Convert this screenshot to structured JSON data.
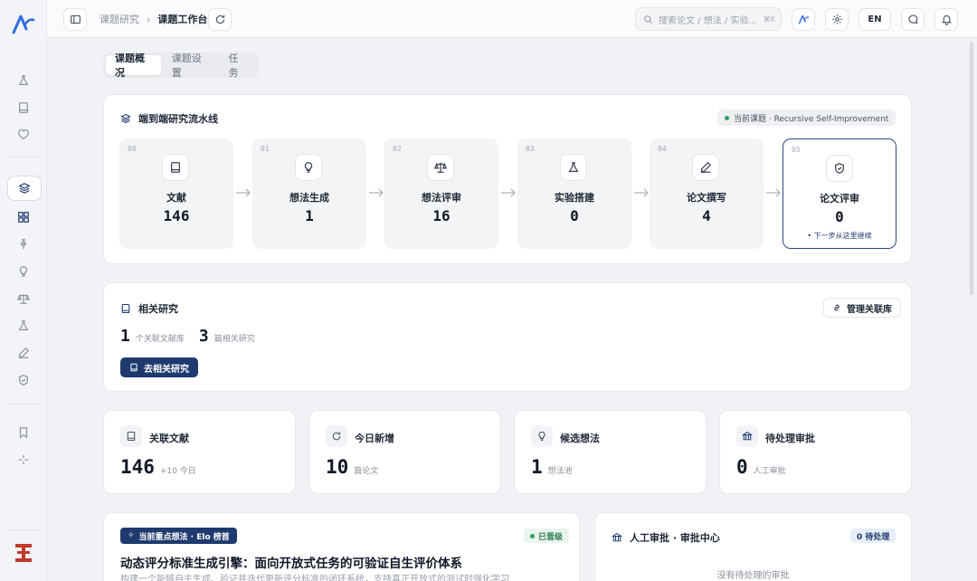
{
  "header": {
    "breadcrumb_parent": "课题研究",
    "breadcrumb_sep": "›",
    "breadcrumb_current": "课题工作台",
    "search_placeholder": "搜索论文 / 想法 / 实验...",
    "search_shortcut": "⌘K",
    "lang_label": "EN"
  },
  "tabs": [
    {
      "label": "课题概况",
      "active": true
    },
    {
      "label": "课题设置",
      "active": false
    },
    {
      "label": "任务",
      "active": false
    }
  ],
  "pipeline": {
    "title": "端到端研究流水线",
    "current_badge": "当前课题 · Recursive Self-Improvement",
    "stages": [
      {
        "num": "00",
        "label": "文献",
        "value": "146",
        "icon": "book-icon"
      },
      {
        "num": "01",
        "label": "想法生成",
        "value": "1",
        "icon": "lightbulb-icon"
      },
      {
        "num": "02",
        "label": "想法评审",
        "value": "16",
        "icon": "scale-icon"
      },
      {
        "num": "03",
        "label": "实验搭建",
        "value": "0",
        "icon": "flask-icon"
      },
      {
        "num": "04",
        "label": "论文撰写",
        "value": "4",
        "icon": "pen-icon"
      },
      {
        "num": "05",
        "label": "论文评审",
        "value": "0",
        "icon": "shield-icon",
        "hint": "• 下一步从这里继续"
      }
    ]
  },
  "related": {
    "title": "相关研究",
    "manage_label": "管理关联库",
    "lib_count": "1",
    "lib_label": "个关联文献库",
    "paper_count": "3",
    "paper_label": "篇相关研究",
    "go_label": "去相关研究"
  },
  "stats": [
    {
      "label": "关联文献",
      "value": "146",
      "sub": "+10 今日",
      "icon": "book-icon"
    },
    {
      "label": "今日新增",
      "value": "10",
      "sub": "篇论文",
      "icon": "refresh-icon"
    },
    {
      "label": "候选想法",
      "value": "1",
      "sub": "想法池",
      "icon": "lightbulb-icon"
    },
    {
      "label": "待处理审批",
      "value": "0",
      "sub": "人工审批",
      "icon": "bank-icon"
    }
  ],
  "focus": {
    "tag": "当前重点想法 · Elo 榜首",
    "status": "已晋级",
    "title": "动态评分标准生成引擎：面向开放式任务的可验证自生评价体系",
    "desc": "构建一个能够自主生成、验证并迭代更新评分标准的闭环系统，支持真正开放式的测试时强化学习"
  },
  "approval": {
    "title": "人工审批 · 审批中心",
    "pending": "0 待处理",
    "empty": "没有待处理的审批"
  },
  "colors": {
    "accent": "#1e3a6e",
    "success": "#2f9e5d"
  }
}
